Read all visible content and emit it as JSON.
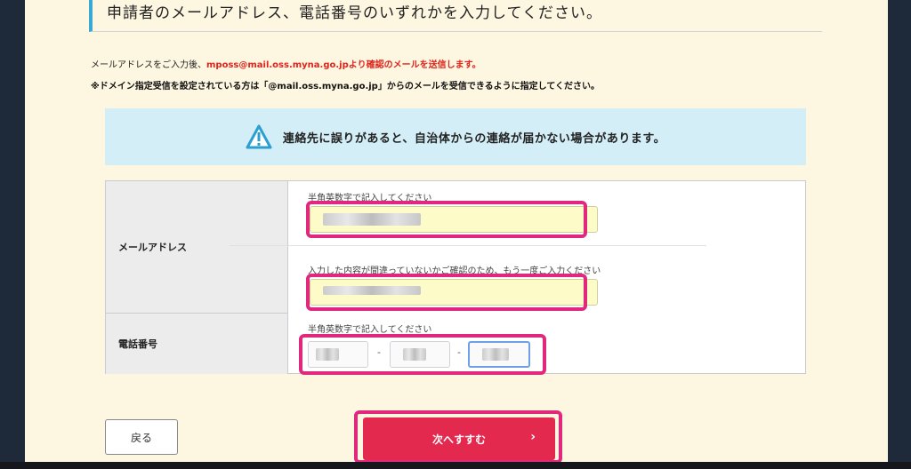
{
  "heading": "申請者のメールアドレス、電話番号のいずれかを入力してください。",
  "note1_prefix": "メールアドレスをご入力後、",
  "note1_red": "mposs@mail.oss.myna.go.jpより確認のメールを送信します。",
  "note2": "※ドメイン指定受信を設定されている方は「@mail.oss.myna.go.jp」からのメールを受信できるように指定してください。",
  "warning": {
    "icon": "warning-icon",
    "text": "連絡先に誤りがあると、自治体からの連絡が届かない場合があります。"
  },
  "form": {
    "email_label": "メールアドレス",
    "email_hint": "半角英数字で記入してください",
    "email_confirm_hint": "入力した内容が間違っていないかご確認のため、もう一度ご入力ください",
    "phone_label": "電話番号",
    "phone_hint": "半角英数字で記入してください",
    "phone_dash": "-"
  },
  "buttons": {
    "back": "戻る",
    "next": "次へすすむ",
    "next_chevron": "›"
  },
  "colors": {
    "highlight": "#e1287c",
    "next_button": "#e4294e",
    "warning_bg": "#d3eef6",
    "accent": "#3aa9d3"
  }
}
